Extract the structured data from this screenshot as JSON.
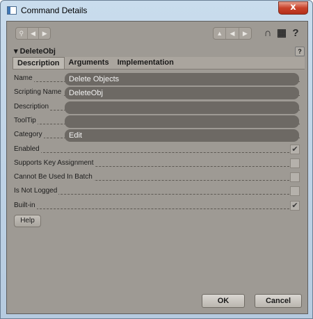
{
  "window": {
    "title": "Command Details",
    "close_label": "x"
  },
  "header": {
    "title": "▾ DeleteObj",
    "help_label": "?"
  },
  "tabs": [
    {
      "label": "Description"
    },
    {
      "label": "Arguments"
    },
    {
      "label": "Implementation"
    }
  ],
  "fields": {
    "name": {
      "label": "Name",
      "value": "Delete Objects"
    },
    "scripting_name": {
      "label": "Scripting Name",
      "value": "DeleteObj"
    },
    "description": {
      "label": "Description",
      "value": ""
    },
    "tooltip": {
      "label": "ToolTip",
      "value": ""
    },
    "category": {
      "label": "Category",
      "value": "Edit"
    }
  },
  "checks": {
    "enabled": {
      "label": "Enabled",
      "checked": true
    },
    "supports_key": {
      "label": "Supports Key Assignment",
      "checked": false
    },
    "cannot_batch": {
      "label": "Cannot Be Used In Batch",
      "checked": false
    },
    "not_logged": {
      "label": "Is Not Logged",
      "checked": false
    },
    "builtin": {
      "label": "Built-in",
      "checked": true
    }
  },
  "buttons": {
    "help": "Help",
    "ok": "OK",
    "cancel": "Cancel"
  },
  "toolbar": {
    "help_icon_label": "?"
  },
  "colors": {
    "panel": "#9e9a94",
    "field": "#6d6964",
    "titlebar": "#c9dced"
  }
}
